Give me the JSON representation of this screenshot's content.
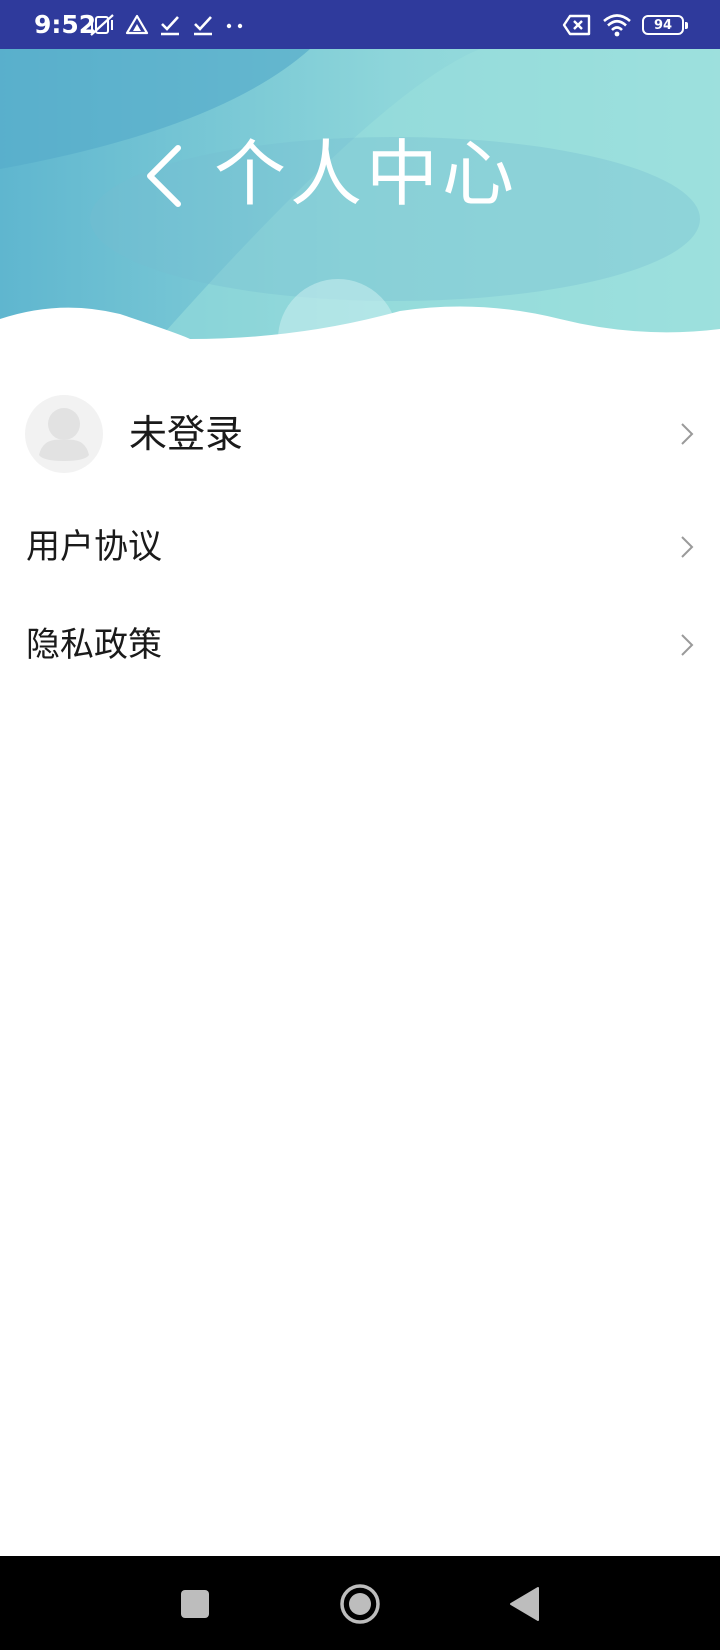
{
  "status_bar": {
    "time": "9:52",
    "battery": "94",
    "left_icons": [
      "mute-vibrate-icon",
      "drive-icon",
      "check-icon",
      "check-icon",
      "more-dots-icon"
    ],
    "right_icons": [
      "no-sim-icon",
      "wifi-icon",
      "battery-icon"
    ]
  },
  "header": {
    "title": "个人中心",
    "back_icon": "chevron-left-icon",
    "gradient_colors": [
      "#5fb6cf",
      "#8ed6da",
      "#9fe0de"
    ]
  },
  "profile": {
    "login_label": "未登录",
    "avatar_icon": "default-avatar-icon"
  },
  "menu": {
    "items": [
      {
        "label": "用户协议"
      },
      {
        "label": "隐私政策"
      }
    ]
  },
  "nav_bar": {
    "buttons": [
      "recent-apps-icon",
      "home-icon",
      "back-icon"
    ]
  },
  "colors": {
    "status_bar": "#2f3a9c",
    "text": "#1a1a1a",
    "chevron": "#9a9a9a"
  }
}
